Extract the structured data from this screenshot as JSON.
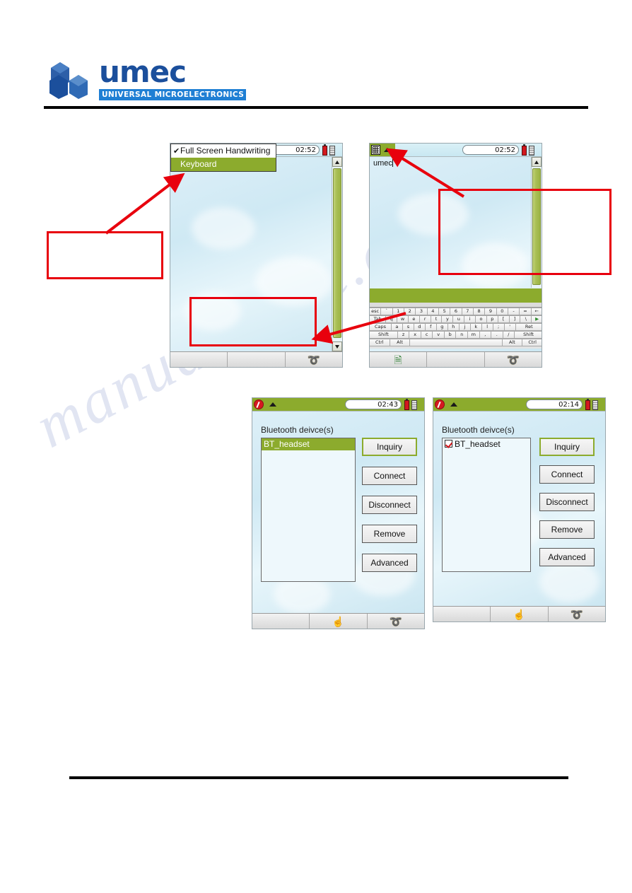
{
  "header": {
    "logo_word": "umec",
    "logo_sub": "UNIVERSAL MICROELECTRONICS"
  },
  "watermark": {
    "text": "manualshive.com"
  },
  "screens": [
    {
      "id": "screen-handwriting-menu",
      "titlebar": {
        "clock": "02:52"
      },
      "menu": {
        "items": [
          {
            "label": "Full Screen Handwriting",
            "checked": true,
            "selected": false,
            "check_glyph": "✔"
          },
          {
            "label": "Keyboard",
            "checked": false,
            "selected": true,
            "check_glyph": ""
          }
        ]
      },
      "scrollbar": {
        "up_icon": "scroll-up-arrow",
        "down_icon": "scroll-down-arrow"
      },
      "toolbar": {
        "cells": [
          "",
          "",
          "curl-icon"
        ],
        "curl_glyph": "➰"
      }
    },
    {
      "id": "screen-keyboard-input",
      "titlebar": {
        "clock": "02:52",
        "icon": "keyboard-icon",
        "tri_icon": "caret-up-icon"
      },
      "input": {
        "value": "umec"
      },
      "keyboard": {
        "rows": [
          [
            "esc",
            "`",
            "1",
            "2",
            "3",
            "4",
            "5",
            "6",
            "7",
            "8",
            "9",
            "0",
            "-",
            "=",
            "←"
          ],
          [
            "Tab",
            "q",
            "w",
            "e",
            "r",
            "t",
            "y",
            "u",
            "i",
            "o",
            "p",
            "[",
            "]",
            "\\",
            "▶"
          ],
          [
            "Caps",
            "a",
            "s",
            "d",
            "f",
            "g",
            "h",
            "j",
            "k",
            "l",
            ";",
            "'",
            "Ret"
          ],
          [
            "Shift",
            "z",
            "x",
            "c",
            "v",
            "b",
            "n",
            "m",
            ",",
            ".",
            "/",
            "Shift"
          ],
          [
            "Ctrl",
            "Alt",
            "",
            "Alt",
            "Ctrl"
          ]
        ]
      },
      "toolbar": {
        "cells": [
          "note-icon",
          "",
          "curl-icon"
        ],
        "note_glyph": "Ὕ2",
        "curl_glyph": "➰"
      }
    },
    {
      "id": "screen-bluetooth-selected",
      "titlebar": {
        "clock": "02:43",
        "icon": "no-entry-icon",
        "tri_icon": "caret-up-icon"
      },
      "label": "Bluetooth deivce(s)",
      "list": [
        {
          "label": "BT_headset",
          "selected": true,
          "checkbox": false,
          "checked": false
        }
      ],
      "buttons": [
        {
          "label": "Inquiry",
          "focused": true
        },
        {
          "label": "Connect",
          "focused": false
        },
        {
          "label": "Disconnect",
          "focused": false
        },
        {
          "label": "Remove",
          "focused": false
        },
        {
          "label": "Advanced",
          "focused": false
        }
      ],
      "toolbar": {
        "cells": [
          "",
          "hand-icon",
          "curl-icon"
        ],
        "hand_glyph": "☝",
        "curl_glyph": "➰"
      }
    },
    {
      "id": "screen-bluetooth-checked",
      "titlebar": {
        "clock": "02:14",
        "icon": "no-entry-icon",
        "tri_icon": "caret-up-icon"
      },
      "label": "Bluetooth deivce(s)",
      "list": [
        {
          "label": "BT_headset",
          "selected": false,
          "checkbox": true,
          "checked": true
        }
      ],
      "buttons": [
        {
          "label": "Inquiry",
          "focused": true
        },
        {
          "label": "Connect",
          "focused": false
        },
        {
          "label": "Disconnect",
          "focused": false
        },
        {
          "label": "Remove",
          "focused": false
        },
        {
          "label": "Advanced",
          "focused": false
        }
      ],
      "toolbar": {
        "cells": [
          "",
          "hand-icon",
          "curl-icon"
        ],
        "hand_glyph": "☝",
        "curl_glyph": "➰"
      }
    }
  ],
  "annotations": {
    "color": "#e8000d",
    "callout_left": {
      "text": ""
    },
    "callout_screen1_bottom": {
      "text": ""
    },
    "callout_screen2": {
      "text": ""
    }
  }
}
